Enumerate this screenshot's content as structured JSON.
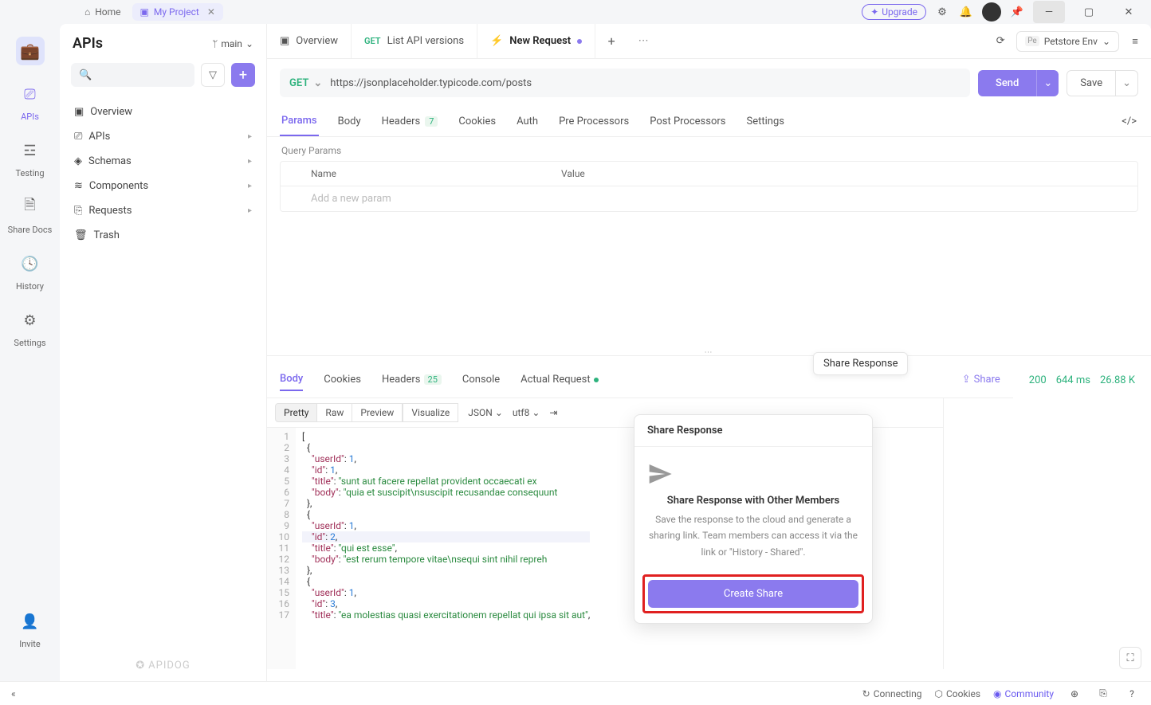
{
  "titlebar": {
    "home": "Home",
    "project": "My Project",
    "upgrade": "Upgrade"
  },
  "rail": {
    "apis": "APIs",
    "testing": "Testing",
    "share": "Share Docs",
    "history": "History",
    "settings": "Settings",
    "invite": "Invite"
  },
  "sidebar": {
    "title": "APIs",
    "branch": "main",
    "items": {
      "overview": "Overview",
      "apis": "APIs",
      "schemas": "Schemas",
      "components": "Components",
      "requests": "Requests",
      "trash": "Trash"
    },
    "logo": "APIDOG"
  },
  "wsTabs": {
    "overview": "Overview",
    "list": "List API versions",
    "new": "New Request"
  },
  "env": {
    "label": "Petstore Env"
  },
  "url": {
    "method": "GET",
    "text": "https://jsonplaceholder.typicode.com/posts",
    "send": "Send",
    "save": "Save"
  },
  "reqTabs": {
    "params": "Params",
    "body": "Body",
    "headers": "Headers",
    "headersCount": "7",
    "cookies": "Cookies",
    "auth": "Auth",
    "pre": "Pre Processors",
    "post": "Post Processors",
    "settings": "Settings"
  },
  "qp": {
    "label": "Query Params",
    "name": "Name",
    "value": "Value",
    "placeholder": "Add a new param"
  },
  "respTabs": {
    "body": "Body",
    "cookies": "Cookies",
    "headers": "Headers",
    "headersCount": "25",
    "console": "Console",
    "actual": "Actual Request",
    "share": "Share"
  },
  "stats": {
    "status": "200",
    "time": "644 ms",
    "size": "26.88 K"
  },
  "respToolbar": {
    "pretty": "Pretty",
    "raw": "Raw",
    "preview": "Preview",
    "visualize": "Visualize",
    "json": "JSON",
    "enc": "utf8"
  },
  "code": {
    "lines": [
      {
        "n": "1",
        "html": "<span class='b'>[</span>"
      },
      {
        "n": "2",
        "html": "  <span class='b'>{</span>"
      },
      {
        "n": "3",
        "html": "    <span class='k'>\"userId\"</span>: <span class='n'>1</span>,"
      },
      {
        "n": "4",
        "html": "    <span class='k'>\"id\"</span>: <span class='n'>1</span>,"
      },
      {
        "n": "5",
        "html": "    <span class='k'>\"title\"</span>: <span class='s'>\"sunt aut facere repellat provident occaecati ex</span>"
      },
      {
        "n": "6",
        "html": "    <span class='k'>\"body\"</span>: <span class='s'>\"quia et suscipit\\nsuscipit recusandae consequunt</span>"
      },
      {
        "n": "7",
        "html": "  <span class='b'>},</span>"
      },
      {
        "n": "8",
        "html": "  <span class='b'>{</span>"
      },
      {
        "n": "9",
        "html": "    <span class='k'>\"userId\"</span>: <span class='n'>1</span>,"
      },
      {
        "n": "10",
        "html": "    <span class='k'>\"id\"</span>: <span class='n'>2</span>,",
        "hl": true
      },
      {
        "n": "11",
        "html": "    <span class='k'>\"title\"</span>: <span class='s'>\"qui est esse\"</span>,"
      },
      {
        "n": "12",
        "html": "    <span class='k'>\"body\"</span>: <span class='s'>\"est rerum tempore vitae\\nsequi sint nihil repreh</span>"
      },
      {
        "n": "13",
        "html": "  <span class='b'>},</span>"
      },
      {
        "n": "14",
        "html": "  <span class='b'>{</span>"
      },
      {
        "n": "15",
        "html": "    <span class='k'>\"userId\"</span>: <span class='n'>1</span>,"
      },
      {
        "n": "16",
        "html": "    <span class='k'>\"id\"</span>: <span class='n'>3</span>,"
      },
      {
        "n": "17",
        "html": "    <span class='k'>\"title\"</span>: <span class='s'>\"ea molestias quasi exercitationem repellat qui ipsa sit aut\"</span>,"
      }
    ]
  },
  "tooltip": "Share Response",
  "popover": {
    "head": "Share Response",
    "title": "Share Response with Other Members",
    "desc": "Save the response to the cloud and generate a sharing link. Team members can access it via the link or \"History - Shared\".",
    "button": "Create Share"
  },
  "statusbar": {
    "connecting": "Connecting",
    "cookies": "Cookies",
    "community": "Community"
  }
}
